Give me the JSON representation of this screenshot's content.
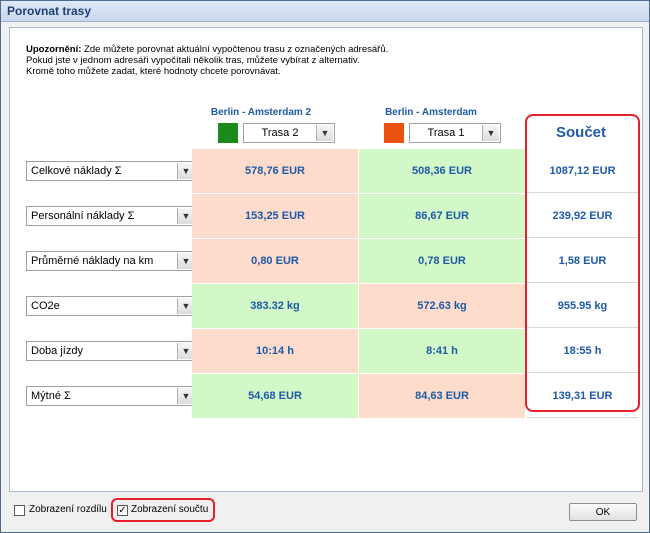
{
  "window": {
    "title": "Porovnat trasy"
  },
  "notice": {
    "bold": "Upozornění:",
    "line1": " Zde můžete porovnat aktuální vypočtenou trasu z označených adresářů.",
    "line2": "Pokud jste v jednom adresáři vypočítali několik tras, můžete vybírat z alternativ.",
    "line3": "Kromě toho můžete zadat, které hodnoty chcete porovnávat."
  },
  "routes": [
    {
      "name": "Berlin - Amsterdam 2",
      "color": "#1a8a1a",
      "selected": "Trasa 2"
    },
    {
      "name": "Berlin - Amsterdam",
      "color": "#e8520e",
      "selected": "Trasa 1"
    }
  ],
  "sum_header": "Součet",
  "rows": [
    {
      "label": "Celkové náklady Σ",
      "v1": "578,76 EUR",
      "v2": "508,36 EUR",
      "sum": "1087,12 EUR"
    },
    {
      "label": "Personální náklady Σ",
      "v1": "153,25 EUR",
      "v2": "86,67 EUR",
      "sum": "239,92 EUR"
    },
    {
      "label": "Průměrné náklady na km",
      "v1": "0,80 EUR",
      "v2": "0,78 EUR",
      "sum": "1,58 EUR"
    },
    {
      "label": "CO2e",
      "v1": "383.32 kg",
      "v2": "572.63 kg",
      "sum": "955.95 kg"
    },
    {
      "label": "Doba jízdy",
      "v1": "10:14 h",
      "v2": "8:41 h",
      "sum": "18:55 h"
    },
    {
      "label": "Mýtné Σ",
      "v1": "54,68 EUR",
      "v2": "84,63 EUR",
      "sum": "139,31 EUR"
    }
  ],
  "footer": {
    "show_diff_label": "Zobrazení rozdílu",
    "show_diff_checked": false,
    "show_sum_label": "Zobrazení součtu",
    "show_sum_checked": true,
    "ok_label": "OK"
  },
  "colors": {
    "accent": "#1e5aa8",
    "better": "#d3f8c8",
    "worse": "#fddccc",
    "highlight": "#e4202a"
  }
}
